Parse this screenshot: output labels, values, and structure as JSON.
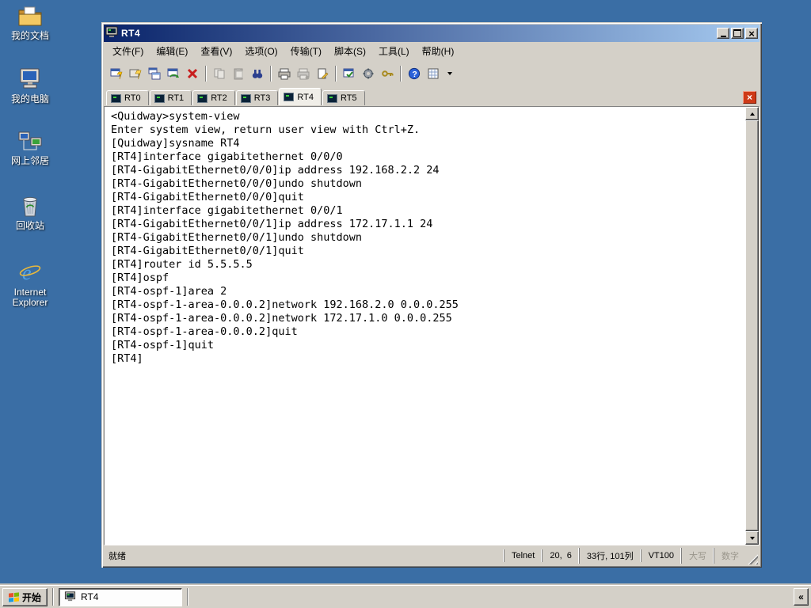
{
  "desktop": {
    "icons": [
      {
        "label": "我的文档"
      },
      {
        "label": "我的电脑"
      },
      {
        "label": "网上邻居"
      },
      {
        "label": "回收站"
      },
      {
        "label": "Internet\nExplorer"
      }
    ]
  },
  "window": {
    "title": "RT4",
    "menu": {
      "items": [
        {
          "label": "文件(F)"
        },
        {
          "label": "编辑(E)"
        },
        {
          "label": "查看(V)"
        },
        {
          "label": "选项(O)"
        },
        {
          "label": "传输(T)"
        },
        {
          "label": "脚本(S)"
        },
        {
          "label": "工具(L)"
        },
        {
          "label": "帮助(H)"
        }
      ]
    },
    "tabs": [
      {
        "label": "RT0"
      },
      {
        "label": "RT1"
      },
      {
        "label": "RT2"
      },
      {
        "label": "RT3"
      },
      {
        "label": "RT4"
      },
      {
        "label": "RT5"
      }
    ],
    "active_tab": "RT4",
    "terminal": {
      "text": "<Quidway>system-view\nEnter system view, return user view with Ctrl+Z.\n[Quidway]sysname RT4\n[RT4]interface gigabitethernet 0/0/0\n[RT4-GigabitEthernet0/0/0]ip address 192.168.2.2 24\n[RT4-GigabitEthernet0/0/0]undo shutdown\n[RT4-GigabitEthernet0/0/0]quit\n[RT4]interface gigabitethernet 0/0/1\n[RT4-GigabitEthernet0/0/1]ip address 172.17.1.1 24\n[RT4-GigabitEthernet0/0/1]undo shutdown\n[RT4-GigabitEthernet0/0/1]quit\n[RT4]router id 5.5.5.5\n[RT4]ospf\n[RT4-ospf-1]area 2\n[RT4-ospf-1-area-0.0.0.2]network 192.168.2.0 0.0.0.255\n[RT4-ospf-1-area-0.0.0.2]network 172.17.1.0 0.0.0.255\n[RT4-ospf-1-area-0.0.0.2]quit\n[RT4-ospf-1]quit\n[RT4]"
    },
    "status": {
      "ready": "就绪",
      "protocol": "Telnet",
      "cursor": "20,  6",
      "grid": "33行, 101列",
      "emulation": "VT100",
      "caps": "大写",
      "num": "数字"
    }
  },
  "taskbar": {
    "start_label": "开始",
    "task_label": "RT4",
    "overflow": "«"
  },
  "colors": {
    "desktop": "#3A6EA5",
    "titlebar_left": "#0A246A",
    "titlebar_right": "#A6CAF0",
    "chrome": "#D4D0C8",
    "tab_close_red": "#CE3A17",
    "terminal_bg": "#FFFFFF",
    "terminal_fg": "#000000"
  }
}
